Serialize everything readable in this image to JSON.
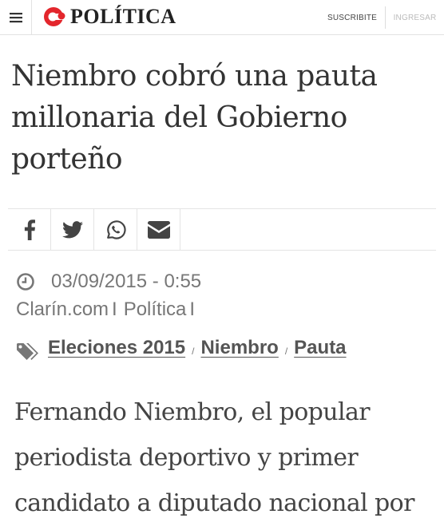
{
  "header": {
    "section": "POLÍTICA",
    "subscribe_label": "SUSCRIBITE",
    "login_label": "INGRESAR"
  },
  "article": {
    "headline": "Niembro cobró una pauta millonaria del Gobierno porteño",
    "date": "03/09/2015 - 0:55",
    "source": "Clarín.com",
    "section": "Política",
    "tags": [
      "Eleciones 2015",
      "Niembro",
      "Pauta"
    ],
    "body": "Fernando Niembro, el popular periodista deportivo y primer candidato a diputado nacional por"
  },
  "share": {
    "icons": [
      "facebook-icon",
      "twitter-icon",
      "whatsapp-icon",
      "email-icon"
    ]
  },
  "colors": {
    "brand": "#e3262c",
    "text": "#333333",
    "meta": "#777777"
  }
}
